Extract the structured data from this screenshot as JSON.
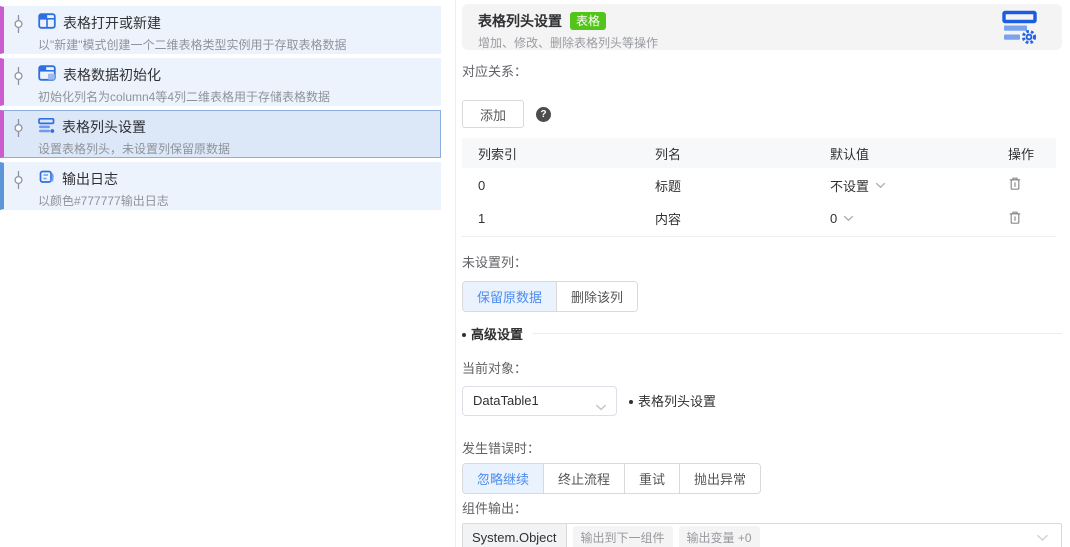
{
  "colors": {
    "node_accent_table": "#cb5cd0",
    "node_accent_log": "#5b97d8",
    "badge_green": "#52c41a",
    "accent_blue": "#4e8cf0",
    "icon_blue": "#2f6fe4"
  },
  "left_panel": {
    "nodes": [
      {
        "icon": "table-new-icon",
        "title": "表格打开或新建",
        "desc": "以\"新建\"模式创建一个二维表格类型实例用于存取表格数据",
        "accent": "#cb5cd0",
        "selected": false
      },
      {
        "icon": "table-init-icon",
        "title": "表格数据初始化",
        "desc": "初始化列名为column4等4列二维表格用于存储表格数据",
        "accent": "#cb5cd0",
        "selected": false
      },
      {
        "icon": "table-header-icon",
        "title": "表格列头设置",
        "desc": "设置表格列头，未设置列保留原数据",
        "accent": "#cb5cd0",
        "selected": true
      },
      {
        "icon": "log-output-icon",
        "title": "输出日志",
        "desc": "以颜色#777777输出日志",
        "accent": "#5b97d8",
        "selected": false
      }
    ]
  },
  "panel": {
    "header": {
      "title": "表格列头设置",
      "badge": "表格",
      "subtitle": "增加、修改、删除表格列头等操作",
      "icon": "table-settings-icon"
    },
    "mapping": {
      "label": "对应关系：",
      "add_button": "添加",
      "help_icon": "?",
      "table": {
        "headers": [
          "列索引",
          "列名",
          "默认值",
          "操作"
        ],
        "rows": [
          {
            "index": "0",
            "name": "标题",
            "default": "不设置"
          },
          {
            "index": "1",
            "name": "内容",
            "default": "0"
          }
        ]
      }
    },
    "unset_column": {
      "label": "未设置列：",
      "options": [
        "保留原数据",
        "删除该列"
      ],
      "selected_index": 0
    },
    "advanced": {
      "label": "高级设置"
    },
    "current_object": {
      "label": "当前对象：",
      "value": "DataTable1",
      "hint": "表格列头设置"
    },
    "on_error": {
      "label": "发生错误时：",
      "options": [
        "忽略继续",
        "终止流程",
        "重试",
        "抛出异常"
      ],
      "selected_index": 0
    },
    "output": {
      "label": "组件输出：",
      "type": "System.Object",
      "chips": [
        "输出到下一组件",
        "输出变量 +0"
      ]
    }
  }
}
